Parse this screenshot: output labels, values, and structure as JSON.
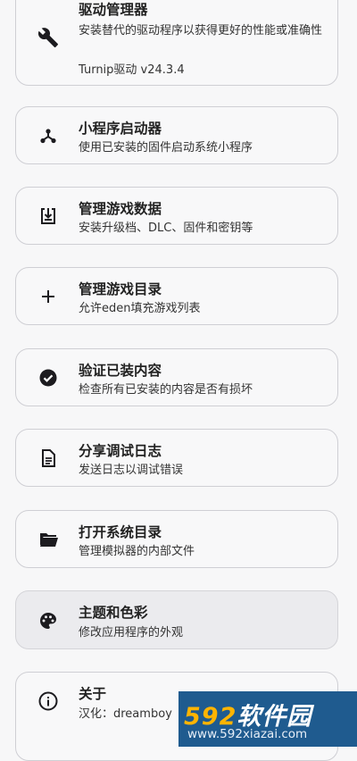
{
  "items": [
    {
      "title": "驱动管理器",
      "description": "安装替代的驱动程序以获得更好的性能或准确性",
      "extra": "Turnip驱动  v24.3.4",
      "icon": "wrench-icon"
    },
    {
      "title": "小程序启动器",
      "description": "使用已安装的固件启动系统小程序",
      "icon": "applet-icon"
    },
    {
      "title": "管理游戏数据",
      "description": "安装升级档、DLC、固件和密钥等",
      "icon": "install-icon"
    },
    {
      "title": "管理游戏目录",
      "description": "允许eden填充游戏列表",
      "icon": "plus-icon"
    },
    {
      "title": "验证已装内容",
      "description": "检查所有已安装的内容是否有损坏",
      "icon": "check-circle-icon"
    },
    {
      "title": "分享调试日志",
      "description": "发送日志以调试错误",
      "icon": "document-icon"
    },
    {
      "title": "打开系统目录",
      "description": "管理模拟器的内部文件",
      "icon": "folder-icon"
    },
    {
      "title": "主题和色彩",
      "description": "修改应用程序的外观",
      "icon": "palette-icon"
    },
    {
      "title": "关于",
      "description": "汉化：dreamboy",
      "icon": "info-icon"
    }
  ],
  "watermark": {
    "num": "592",
    "text": "软件园",
    "url": "www.592xiazai.com"
  }
}
